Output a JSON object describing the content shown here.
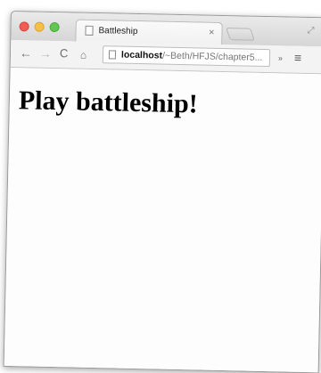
{
  "tab": {
    "title": "Battleship",
    "close_icon": "close-icon"
  },
  "toolbar": {
    "back_icon": "←",
    "forward_icon": "→",
    "reload_icon": "C",
    "home_icon": "🏠",
    "url_host": "localhost",
    "url_path": "/~Beth/HFJS/chapter5...",
    "extensions_icon": "»",
    "menu_icon": "≡"
  },
  "page": {
    "heading": "Play battleship!"
  }
}
